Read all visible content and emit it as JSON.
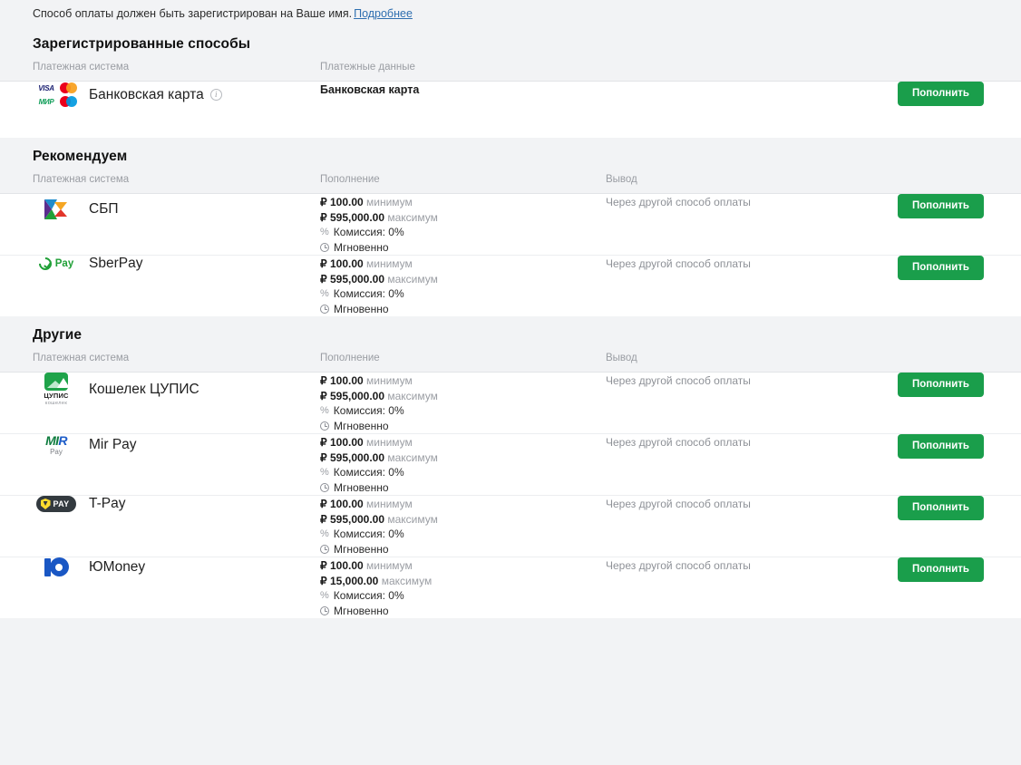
{
  "intro": {
    "text": "Способ оплаты должен быть зарегистрирован на Ваше имя.",
    "link_label": "Подробнее"
  },
  "colors": {
    "accent_green": "#1a9e4b",
    "link_blue": "#2f6fb0",
    "page_bg": "#f2f3f5",
    "muted_text": "#9a9da3"
  },
  "labels": {
    "col_system": "Платежная система",
    "col_payment_data": "Платежные данные",
    "col_topup": "Пополнение",
    "col_withdraw": "Вывод",
    "min_suffix": "минимум",
    "max_suffix": "максимум",
    "button": "Пополнить",
    "withdraw_value": "Через другой способ оплаты",
    "info_icon_glyph": "i",
    "percent_glyph": "%"
  },
  "sections": [
    {
      "title": "Зарегистрированные способы",
      "type": "registered",
      "columns": [
        "Платежная система",
        "Платежные данные"
      ],
      "rows": [
        {
          "logo": "bank-cards",
          "name": "Банковская карта",
          "has_info_icon": true,
          "payment_data": "Банковская карта",
          "button": "Пополнить",
          "card_brands": [
            "VISA",
            "Mastercard",
            "МИР",
            "Maestro"
          ]
        }
      ]
    },
    {
      "title": "Рекомендуем",
      "type": "limits",
      "columns": [
        "Платежная система",
        "Пополнение",
        "Вывод"
      ],
      "rows": [
        {
          "logo": "sbp",
          "name": "СБП",
          "min": "₽ 100.00",
          "max": "₽ 595,000.00",
          "fee": "Комиссия: 0%",
          "speed": "Мгновенно",
          "withdraw": "Через другой способ оплаты",
          "button": "Пополнить"
        },
        {
          "logo": "sberpay",
          "logo_text": "Pay",
          "name": "SberPay",
          "min": "₽ 100.00",
          "max": "₽ 595,000.00",
          "fee": "Комиссия: 0%",
          "speed": "Мгновенно",
          "withdraw": "Через другой способ оплаты",
          "button": "Пополнить"
        }
      ]
    },
    {
      "title": "Другие",
      "type": "limits",
      "columns": [
        "Платежная система",
        "Пополнение",
        "Вывод"
      ],
      "rows": [
        {
          "logo": "cupis",
          "logo_text": "ЦУПИС",
          "logo_subtext": "кошелек",
          "name": "Кошелек ЦУПИС",
          "min": "₽ 100.00",
          "max": "₽ 595,000.00",
          "fee": "Комиссия: 0%",
          "speed": "Мгновенно",
          "withdraw": "Через другой способ оплаты",
          "button": "Пополнить"
        },
        {
          "logo": "mirpay",
          "logo_text": "MIR",
          "logo_subtext": "Pay",
          "name": "Mir Pay",
          "min": "₽ 100.00",
          "max": "₽ 595,000.00",
          "fee": "Комиссия: 0%",
          "speed": "Мгновенно",
          "withdraw": "Через другой способ оплаты",
          "button": "Пополнить"
        },
        {
          "logo": "tpay",
          "logo_text": "PAY",
          "name": "T-Pay",
          "min": "₽ 100.00",
          "max": "₽ 595,000.00",
          "fee": "Комиссия: 0%",
          "speed": "Мгновенно",
          "withdraw": "Через другой способ оплаты",
          "button": "Пополнить"
        },
        {
          "logo": "yoomoney",
          "name": "ЮMoney",
          "min": "₽ 100.00",
          "max": "₽ 15,000.00",
          "fee": "Комиссия: 0%",
          "speed": "Мгновенно",
          "withdraw": "Через другой способ оплаты",
          "button": "Пополнить"
        }
      ]
    }
  ]
}
